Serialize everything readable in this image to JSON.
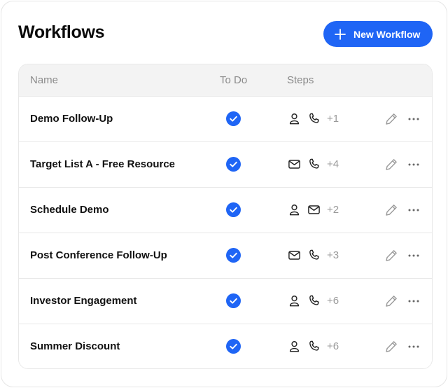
{
  "page": {
    "title": "Workflows",
    "new_button_label": "New Workflow",
    "new_button_icon": "plus-icon",
    "accent_color": "#1f65f5"
  },
  "table": {
    "columns": [
      "Name",
      "To Do",
      "Steps"
    ],
    "rows": [
      {
        "name": "Demo Follow-Up",
        "todo": true,
        "steps": [
          "user-icon",
          "phone-icon"
        ],
        "more": "+1"
      },
      {
        "name": "Target List A - Free Resource",
        "todo": true,
        "steps": [
          "mail-icon",
          "phone-icon"
        ],
        "more": "+4"
      },
      {
        "name": "Schedule Demo",
        "todo": true,
        "steps": [
          "user-icon",
          "mail-icon"
        ],
        "more": "+2"
      },
      {
        "name": "Post Conference Follow-Up",
        "todo": true,
        "steps": [
          "mail-icon",
          "phone-icon"
        ],
        "more": "+3"
      },
      {
        "name": "Investor Engagement",
        "todo": true,
        "steps": [
          "user-icon",
          "phone-icon"
        ],
        "more": "+6"
      },
      {
        "name": "Summer Discount",
        "todo": true,
        "steps": [
          "user-icon",
          "phone-icon"
        ],
        "more": "+6"
      }
    ]
  }
}
